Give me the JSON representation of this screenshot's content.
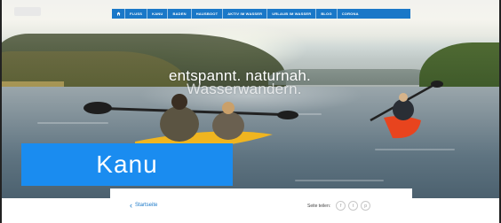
{
  "nav": {
    "home_icon": "home-icon",
    "items": [
      "FLUSS",
      "KANU",
      "BADEN",
      "HAUSBOOT",
      "AKTIV IM WASSER",
      "URLAUB IM WASSER",
      "BLOG",
      "CORONA"
    ]
  },
  "hero": {
    "headline_line1": "entspannt. naturnah.",
    "headline_line2": "Wasserwandern."
  },
  "category": {
    "label": "Kanu"
  },
  "card": {
    "back_label": "Startseite",
    "share_label": "Seite teilen:",
    "share_icons": [
      "facebook-icon",
      "twitter-icon",
      "pinterest-icon"
    ]
  },
  "colors": {
    "accent": "#1a8cf0",
    "nav": "#1a78c8"
  }
}
